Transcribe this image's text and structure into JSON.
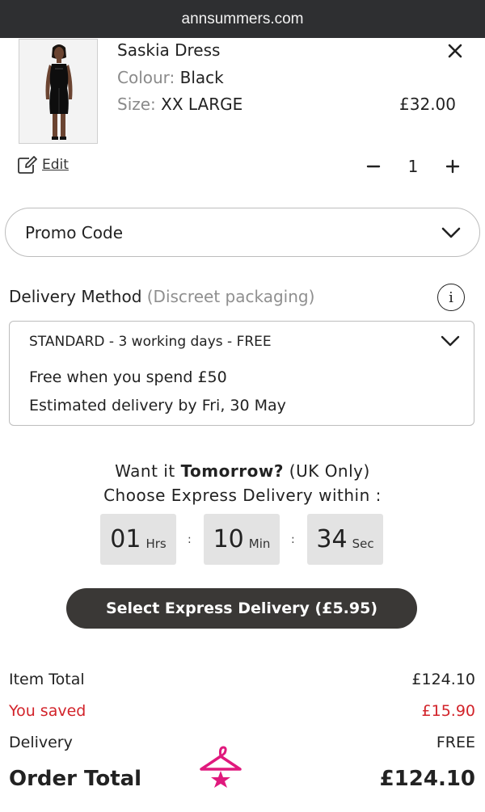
{
  "browser": {
    "url": "annsummers.com"
  },
  "product": {
    "name": "Saskia Dress",
    "colour_label": "Colour:",
    "colour_value": "Black",
    "size_label": "Size:",
    "size_value": "XX LARGE",
    "price": "£32.00",
    "edit_label": "Edit",
    "quantity": "1"
  },
  "promo": {
    "label": "Promo Code"
  },
  "delivery": {
    "title": "Delivery Method",
    "subtitle": "(Discreet packaging)",
    "selected_option": "STANDARD - 3 working days - FREE",
    "line1": "Free when you spend £50",
    "line2": "Estimated delivery by Fri, 30 May"
  },
  "express": {
    "want_prefix": "Want it ",
    "want_bold": "Tomorrow?",
    "want_suffix": " (UK Only)",
    "choose_text": "Choose Express Delivery within :",
    "hours": "01",
    "hours_unit": "Hrs",
    "minutes": "10",
    "minutes_unit": "Min",
    "seconds": "34",
    "seconds_unit": "Sec",
    "separator": ":",
    "button_label": "Select Express Delivery (£5.95)"
  },
  "summary": {
    "item_total_label": "Item Total",
    "item_total_value": "£124.10",
    "saved_label": "You saved",
    "saved_value": "£15.90",
    "delivery_label": "Delivery",
    "delivery_value": "FREE",
    "order_total_label": "Order Total",
    "order_total_value": "£124.10"
  },
  "colors": {
    "accent_pink": "#e0197d",
    "saved_red": "#d2232a",
    "button_dark": "#3a3836"
  },
  "icons": [
    "close-icon",
    "edit-icon",
    "minus-icon",
    "plus-icon",
    "chevron-down-icon",
    "info-icon",
    "hanger-logo-icon"
  ]
}
